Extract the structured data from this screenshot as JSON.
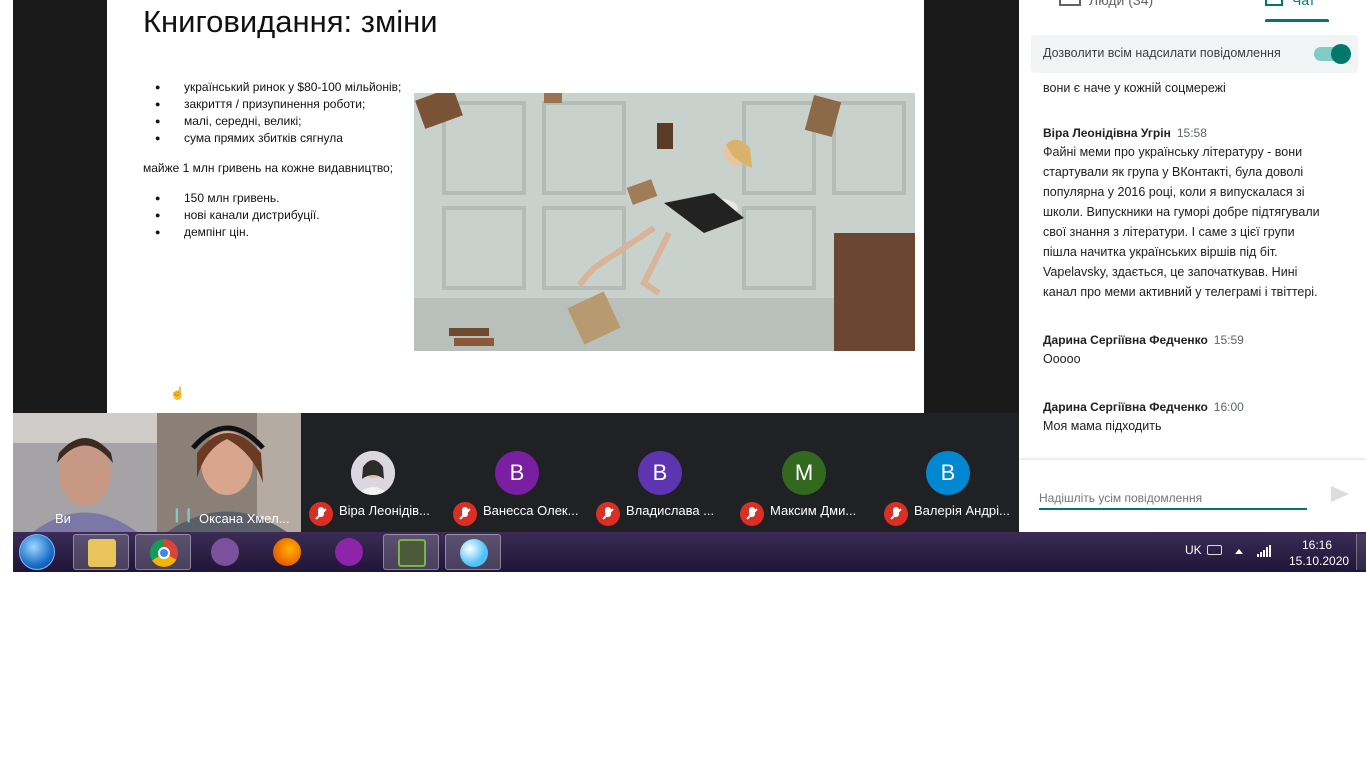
{
  "slide": {
    "title": "Книговидання: зміни",
    "bullets_a": [
      "український ринок у $80-100 мільйонів;",
      "закриття / призупинення роботи;",
      "малі, середні, великі;",
      "сума прямих збитків сягнула"
    ],
    "paragraph": "майже 1 млн гривень на кожне видавництво;",
    "bullets_b": [
      "150 млн гривень.",
      "нові канали дистрибуції.",
      "демпінг цін."
    ]
  },
  "chat": {
    "tab_people": "Люди (34)",
    "tab_chat": "Чат",
    "allow_all_label": "Дозволити всім надсилати повідомлення",
    "allow_all_on": true,
    "prev_message_tail": "вони є наче у кожній соцмережі",
    "messages": [
      {
        "sender": "Віра Леонідівна Угрін",
        "time": "15:58",
        "lines": [
          "Файні меми про українську літературу - вони",
          "стартували як група у ВКонтакті, була доволі",
          "популярна у 2016 році, коли я випускалася зі",
          "школи. Випускники на гуморі добре підтягували",
          "свої знання з літератури. І саме з цієї групи",
          "пішла начитка українських віршів під біт.",
          "Vapelavsky, здається, це започаткував. Нині",
          "канал про меми активний у телеграмі і твіттері."
        ]
      },
      {
        "sender": "Дарина Сергіївна Федченко",
        "time": "15:59",
        "lines": [
          "Ооооо"
        ]
      },
      {
        "sender": "Дарина Сергіївна Федченко",
        "time": "16:00",
        "lines": [
          "Моя мама підходить"
        ]
      }
    ],
    "input_placeholder": "Надішліть усім повідомлення"
  },
  "participants": {
    "self_label": "Ви",
    "speaker_name": "Оксана Хмел...",
    "others": [
      {
        "name": "Віра Леонідів...",
        "initial": "",
        "color": "#e8e8ee"
      },
      {
        "name": "Ванесса Олек...",
        "initial": "В",
        "color": "#7b1fa2"
      },
      {
        "name": "Владислава ...",
        "initial": "В",
        "color": "#5e35b1"
      },
      {
        "name": "Максим Дми...",
        "initial": "М",
        "color": "#33691e"
      },
      {
        "name": "Валерія Андрі...",
        "initial": "В",
        "color": "#0288d1"
      }
    ]
  },
  "taskbar": {
    "apps": [
      {
        "name": "explorer",
        "color": "#e8c45a"
      },
      {
        "name": "chrome",
        "color": "#db4437"
      },
      {
        "name": "viber",
        "color": "#7b519d"
      },
      {
        "name": "firefox",
        "color": "#e66000"
      },
      {
        "name": "podcast",
        "color": "#8e24aa"
      },
      {
        "name": "monitor",
        "color": "#7cb342"
      },
      {
        "name": "paint",
        "color": "#4fc3f7"
      }
    ],
    "language": "UK",
    "time": "16:16",
    "date": "15.10.2020"
  }
}
